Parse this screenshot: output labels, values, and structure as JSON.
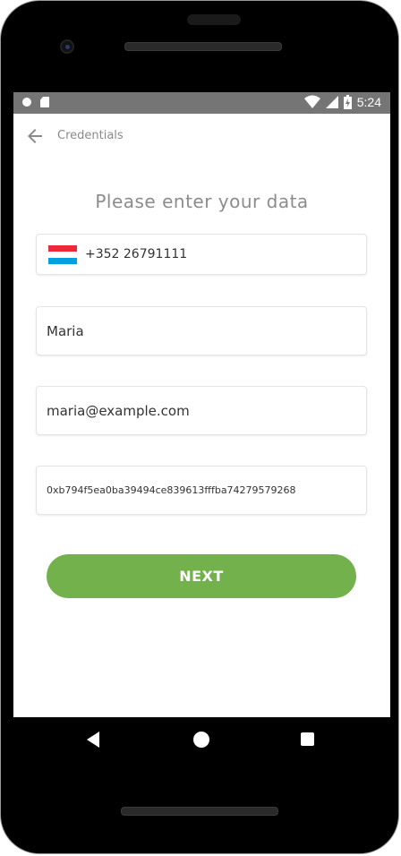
{
  "status_bar": {
    "time": "5:24",
    "icons": [
      "notification-circle-icon",
      "sd-card-icon",
      "wifi-icon",
      "signal-icon",
      "battery-charging-icon"
    ]
  },
  "app_bar": {
    "back_icon": "arrow-left-icon",
    "title": "Credentials"
  },
  "form": {
    "headline": "Please enter your data",
    "phone": {
      "flag_icon": "luxembourg-flag-icon",
      "value": "+352 26791111"
    },
    "name": {
      "value": "Maria"
    },
    "email": {
      "value": "maria@example.com"
    },
    "address": {
      "value": "0xb794f5ea0ba39494ce839613fffba74279579268"
    },
    "next_label": "NEXT"
  },
  "colors": {
    "accent": "#72b14b",
    "status_bar": "#757575",
    "flag": [
      "#ED2939",
      "#FFFFFF",
      "#00A1DE"
    ]
  },
  "nav_bar": {
    "buttons": [
      "back-icon",
      "home-icon",
      "recents-icon"
    ]
  }
}
